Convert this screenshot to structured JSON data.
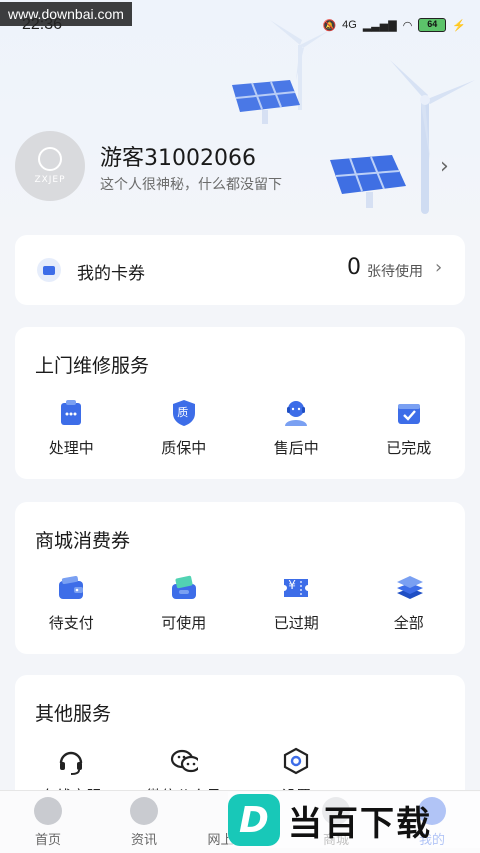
{
  "watermark_url": "www.downbai.com",
  "status": {
    "time": "22:36",
    "network": "4G",
    "battery": "64"
  },
  "profile": {
    "avatar_text": "ZXJEP",
    "name": "游客31002066",
    "bio": "这个人很神秘，什么都没留下"
  },
  "coupon": {
    "title": "我的卡券",
    "count": "0",
    "status_text": "张待使用"
  },
  "repair": {
    "title": "上门维修服务",
    "items": [
      {
        "label": "处理中",
        "icon": "clipboard-icon"
      },
      {
        "label": "质保中",
        "icon": "shield-icon",
        "badge": "质"
      },
      {
        "label": "售后中",
        "icon": "support-agent-icon"
      },
      {
        "label": "已完成",
        "icon": "check-box-icon"
      }
    ]
  },
  "mall": {
    "title": "商城消费券",
    "items": [
      {
        "label": "待支付",
        "icon": "wallet-icon"
      },
      {
        "label": "可使用",
        "icon": "ticket-wallet-icon"
      },
      {
        "label": "已过期",
        "icon": "expired-ticket-icon",
        "badge": "¥"
      },
      {
        "label": "全部",
        "icon": "layers-icon"
      }
    ]
  },
  "other": {
    "title": "其他服务",
    "items": [
      {
        "label": "在线客服",
        "icon": "headset-icon"
      },
      {
        "label": "微信公众号",
        "icon": "wechat-icon"
      },
      {
        "label": "设置",
        "icon": "settings-hex-icon"
      }
    ]
  },
  "tabs": [
    {
      "label": "首页"
    },
    {
      "label": "资讯"
    },
    {
      "label": "网上营业厅"
    },
    {
      "label": "商城"
    },
    {
      "label": "我的"
    }
  ],
  "brand_watermark": {
    "letter": "D",
    "text": "当百下载"
  },
  "colors": {
    "accent": "#3d6de8",
    "background": "#f3f5f9"
  }
}
